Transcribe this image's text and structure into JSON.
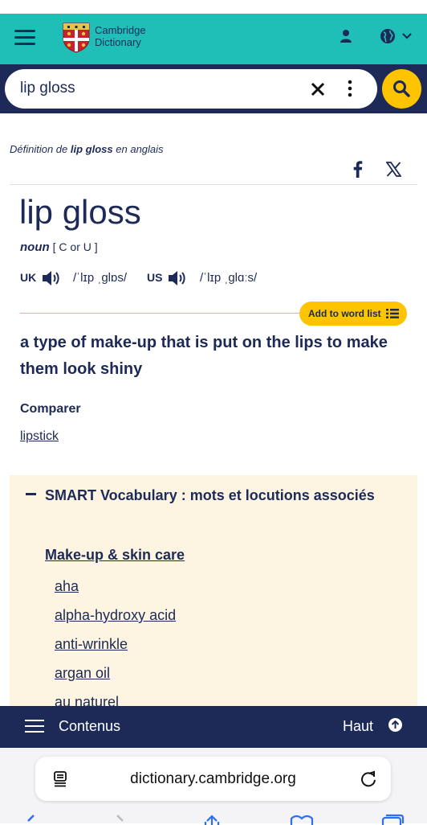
{
  "header": {
    "logo_line1": "Cambridge",
    "logo_line2": "Dictionary",
    "icons": [
      "menu-icon",
      "user-icon",
      "globe-icon",
      "chevron-down-icon"
    ]
  },
  "search": {
    "value": "lip gloss",
    "icons": [
      "clear-icon",
      "more-vertical-icon",
      "search-icon"
    ]
  },
  "entry": {
    "definition_of_prefix": "Définition de",
    "definition_of_word": "lip gloss",
    "definition_of_suffix": "en anglais",
    "headword": "lip gloss",
    "pos": "noun",
    "grammar": "[ C or U ]",
    "uk_label": "UK",
    "uk_ipa": "/ˈlɪp ˌɡlɒs/",
    "us_label": "US",
    "us_ipa": "/ˈlɪp ˌɡlɑːs/",
    "add_to_word_list": "Add to word list",
    "definition": "a type of make-up that is put on the lips to make them look shiny",
    "compare_label": "Comparer",
    "compare_link": "lipstick"
  },
  "smart_vocab": {
    "title": "SMART Vocabulary : mots et locutions associés",
    "category": "Make-up & skin care",
    "items": [
      "aha",
      "alpha-hydroxy acid",
      "anti-wrinkle",
      "argan oil",
      "au naturel"
    ]
  },
  "bottom_bar": {
    "contents": "Contenus",
    "top": "Haut"
  },
  "browser": {
    "url": "dictionary.cambridge.org"
  },
  "colors": {
    "teal": "#1fbfb8",
    "navy": "#1d2a57",
    "yellow": "#fec400",
    "cream": "#fdf5e1"
  }
}
